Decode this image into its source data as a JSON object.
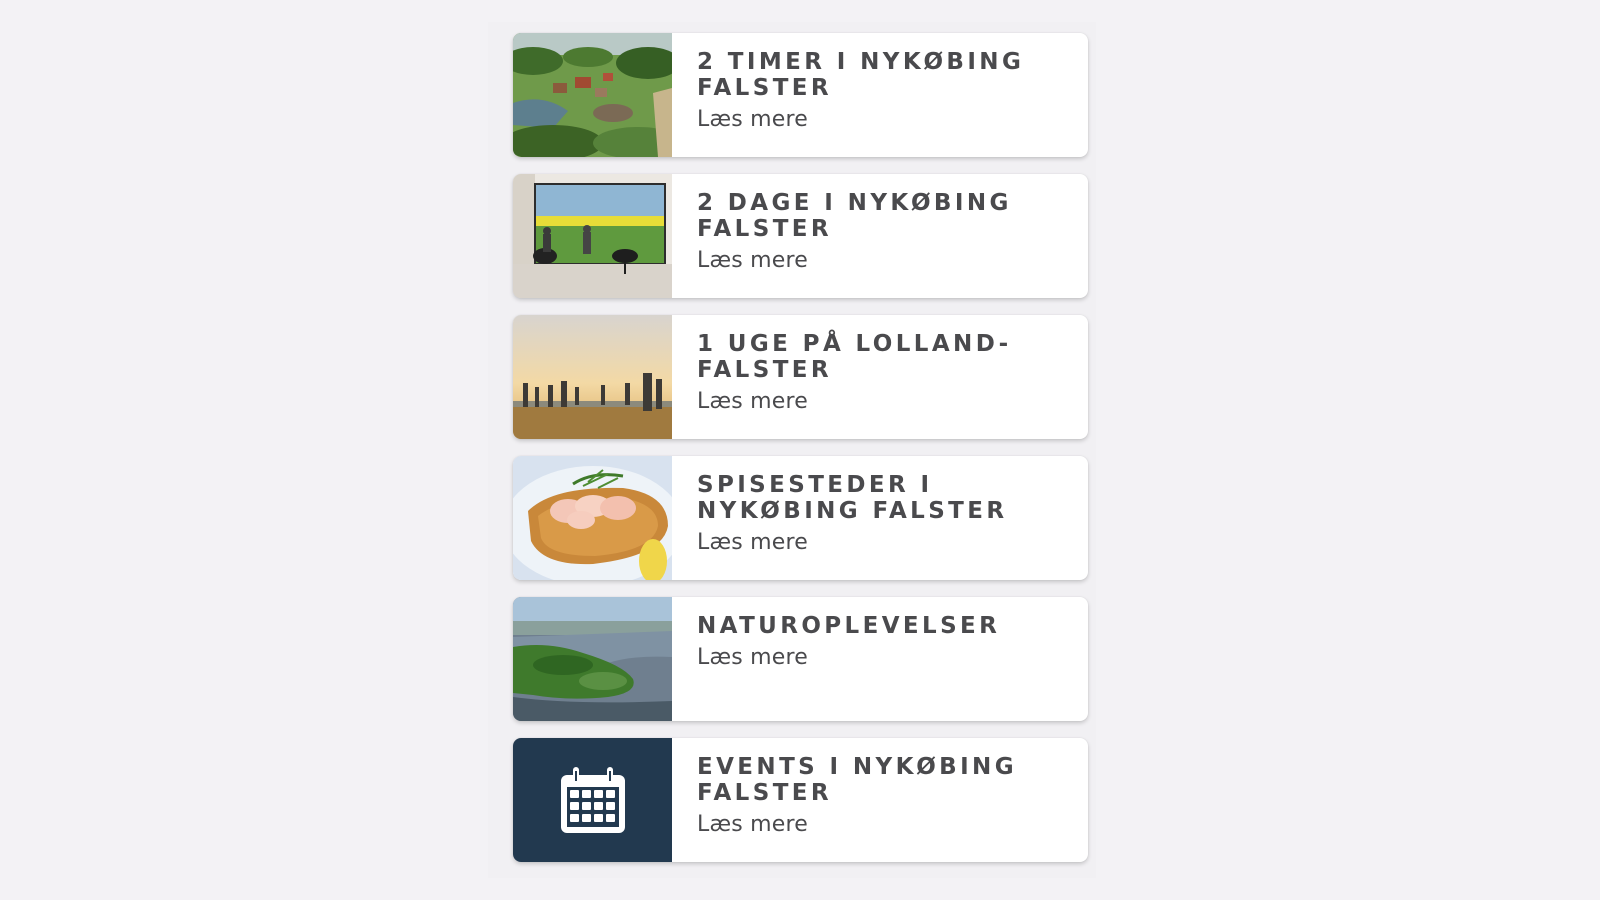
{
  "items": [
    {
      "title": "2 TIMER I NYKØBING FALSTER",
      "link_label": "Læs mere",
      "image": "village-aerial-photo"
    },
    {
      "title": "2 DAGE I NYKØBING FALSTER",
      "link_label": "Læs mere",
      "image": "museum-window-field-photo"
    },
    {
      "title": "1 UGE PÅ LOLLAND-FALSTER",
      "link_label": "Læs mere",
      "image": "sculptures-sunset-photo"
    },
    {
      "title": "SPISESTEDER I NYKØBING FALSTER",
      "link_label": "Læs mere",
      "image": "shrimp-fish-dish-photo"
    },
    {
      "title": "NATUROPLEVELSER",
      "link_label": "Læs mere",
      "image": "coast-aerial-photo"
    },
    {
      "title": "EVENTS I NYKØBING FALSTER",
      "link_label": "Læs mere",
      "image": "calendar-icon"
    }
  ],
  "colors": {
    "background": "#f3f2f5",
    "card": "#ffffff",
    "text": "#4a4a4d",
    "events_tile": "#22394f"
  }
}
